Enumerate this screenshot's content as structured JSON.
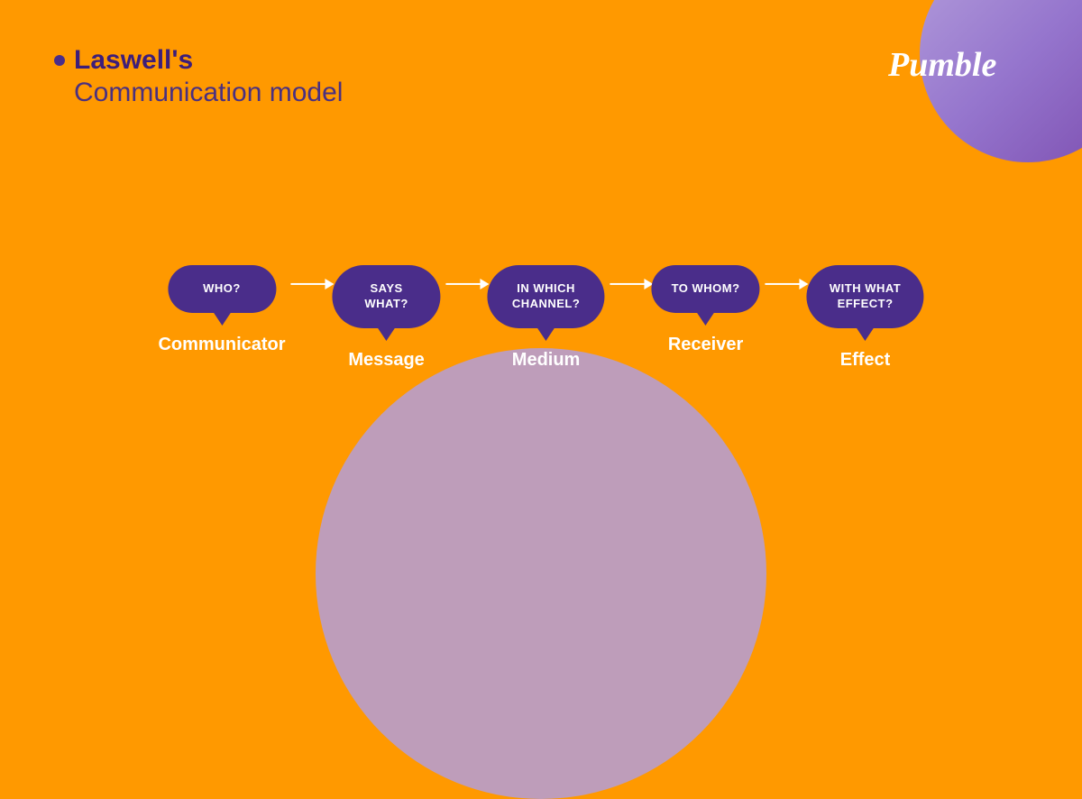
{
  "background_color": "#FF9900",
  "title": {
    "bullet_label": "•",
    "line1": "Laswell's",
    "line2": "Communication model"
  },
  "logo": {
    "text": "Pumble",
    "color": "#ffffff"
  },
  "steps": [
    {
      "id": "communicator",
      "bubble_text": "WHO?",
      "label": "Communicator"
    },
    {
      "id": "message",
      "bubble_text": "SAYS WHAT?",
      "label": "Message"
    },
    {
      "id": "medium",
      "bubble_text": "IN WHICH\nCHANNEL?",
      "label": "Medium"
    },
    {
      "id": "receiver",
      "bubble_text": "TO WHOM?",
      "label": "Receiver"
    },
    {
      "id": "effect",
      "bubble_text": "WITH WHAT\nEFFECT?",
      "label": "Effect"
    }
  ],
  "arrows": [
    "→",
    "→",
    "→",
    "→"
  ],
  "colors": {
    "background": "#FF9900",
    "bubble_bg": "#4a2d8a",
    "bubble_text": "#ffffff",
    "label_text": "#ffffff",
    "title_bold": "#3d1e7a",
    "title_normal": "#4a3080",
    "circle_gradient_start": "#b39ddb",
    "circle_gradient_end": "#7c4daf",
    "bottom_circle": "#c4a8e0"
  }
}
